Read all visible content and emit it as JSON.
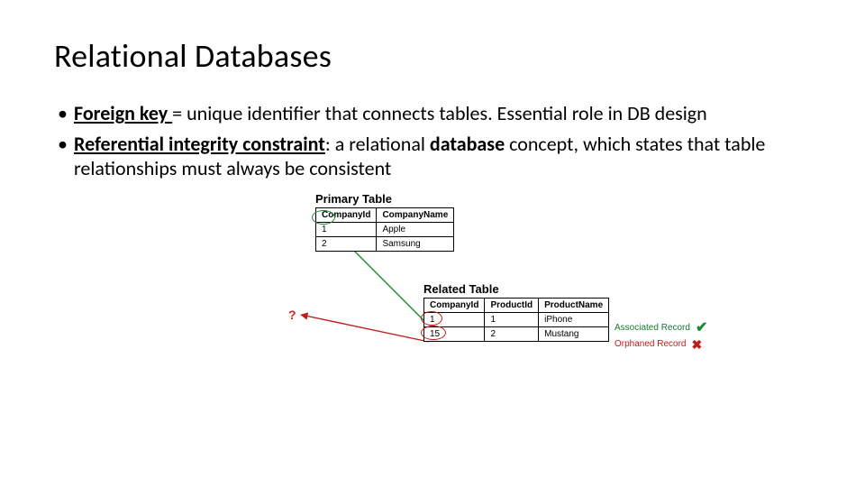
{
  "title": "Relational Databases",
  "bullets": [
    {
      "term": "Foreign key ",
      "rest": "= unique identifier that connects tables. Essential role in DB design"
    },
    {
      "term": "Referential integrity constraint",
      "rest": ": a relational ",
      "bold": "database",
      "rest2": " concept, which states that table relationships must always be consistent"
    }
  ],
  "diagram": {
    "primary": {
      "title": "Primary Table",
      "headers": [
        "CompanyId",
        "CompanyName"
      ],
      "rows": [
        [
          "1",
          "Apple"
        ],
        [
          "2",
          "Samsung"
        ]
      ]
    },
    "related": {
      "title": "Related Table",
      "headers": [
        "CompanyId",
        "ProductId",
        "ProductName"
      ],
      "rows": [
        [
          "1",
          "1",
          "iPhone"
        ],
        [
          "15",
          "2",
          "Mustang"
        ]
      ]
    },
    "legend": {
      "assoc": "Associated Record",
      "orph": "Orphaned Record"
    },
    "qmark": "?"
  },
  "chart_data": {
    "type": "table",
    "tables": [
      {
        "name": "Primary Table",
        "columns": [
          "CompanyId",
          "CompanyName"
        ],
        "rows": [
          [
            1,
            "Apple"
          ],
          [
            2,
            "Samsung"
          ]
        ]
      },
      {
        "name": "Related Table",
        "columns": [
          "CompanyId",
          "ProductId",
          "ProductName"
        ],
        "rows": [
          [
            1,
            1,
            "iPhone"
          ],
          [
            15,
            2,
            "Mustang"
          ]
        ],
        "annotations": [
          "Associated Record",
          "Orphaned Record"
        ]
      }
    ]
  }
}
